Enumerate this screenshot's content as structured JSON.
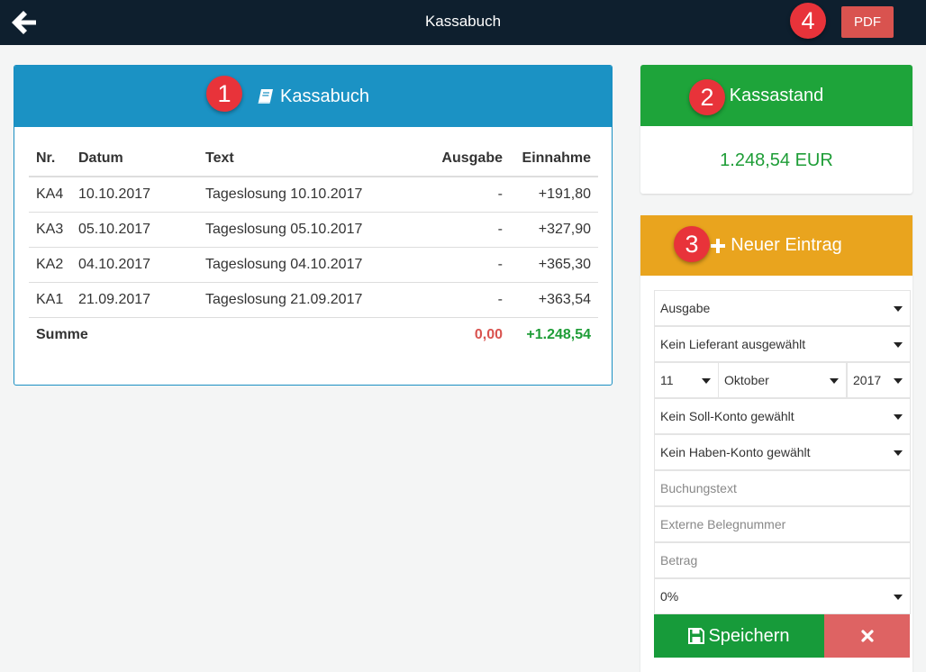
{
  "header": {
    "title": "Kassabuch",
    "back_icon": "arrow-left-icon",
    "pdf_label": "PDF"
  },
  "badges": [
    "1",
    "2",
    "3",
    "4"
  ],
  "kassabuch": {
    "title": "Kassabuch",
    "icon": "book-icon",
    "columns": [
      "Nr.",
      "Datum",
      "Text",
      "Ausgabe",
      "Einnahme"
    ],
    "rows": [
      {
        "nr": "KA4",
        "datum": "10.10.2017",
        "text": "Tageslosung 10.10.2017",
        "ausgabe": "-",
        "einnahme": "+191,80"
      },
      {
        "nr": "KA3",
        "datum": "05.10.2017",
        "text": "Tageslosung 05.10.2017",
        "ausgabe": "-",
        "einnahme": "+327,90"
      },
      {
        "nr": "KA2",
        "datum": "04.10.2017",
        "text": "Tageslosung 04.10.2017",
        "ausgabe": "-",
        "einnahme": "+365,30"
      },
      {
        "nr": "KA1",
        "datum": "21.09.2017",
        "text": "Tageslosung 21.09.2017",
        "ausgabe": "-",
        "einnahme": "+363,54"
      }
    ],
    "sum": {
      "label": "Summe",
      "ausgabe": "0,00",
      "einnahme": "+1.248,54"
    }
  },
  "kassastand": {
    "title": "Kassastand",
    "value": "1.248,54 EUR"
  },
  "neuer_eintrag": {
    "title": "Neuer Eintrag",
    "icon": "plus-icon",
    "type_select": "Ausgabe",
    "lieferant_select": "Kein Lieferant ausgewählt",
    "day_select": "11",
    "month_select": "Oktober",
    "year_select": "2017",
    "soll_select": "Kein Soll-Konto gewählt",
    "haben_select": "Kein Haben-Konto gewählt",
    "buchungstext_placeholder": "Buchungstext",
    "belegnummer_placeholder": "Externe Belegnummer",
    "betrag_placeholder": "Betrag",
    "tax_select": "0%",
    "save_label": "Speichern",
    "save_icon": "floppy-disk-icon",
    "cancel_icon": "close-icon"
  },
  "colors": {
    "topbar": "#0e1f2e",
    "blue": "#1b92c4",
    "green": "#1ea43a",
    "orange": "#e9a41e",
    "red": "#d9534f"
  }
}
